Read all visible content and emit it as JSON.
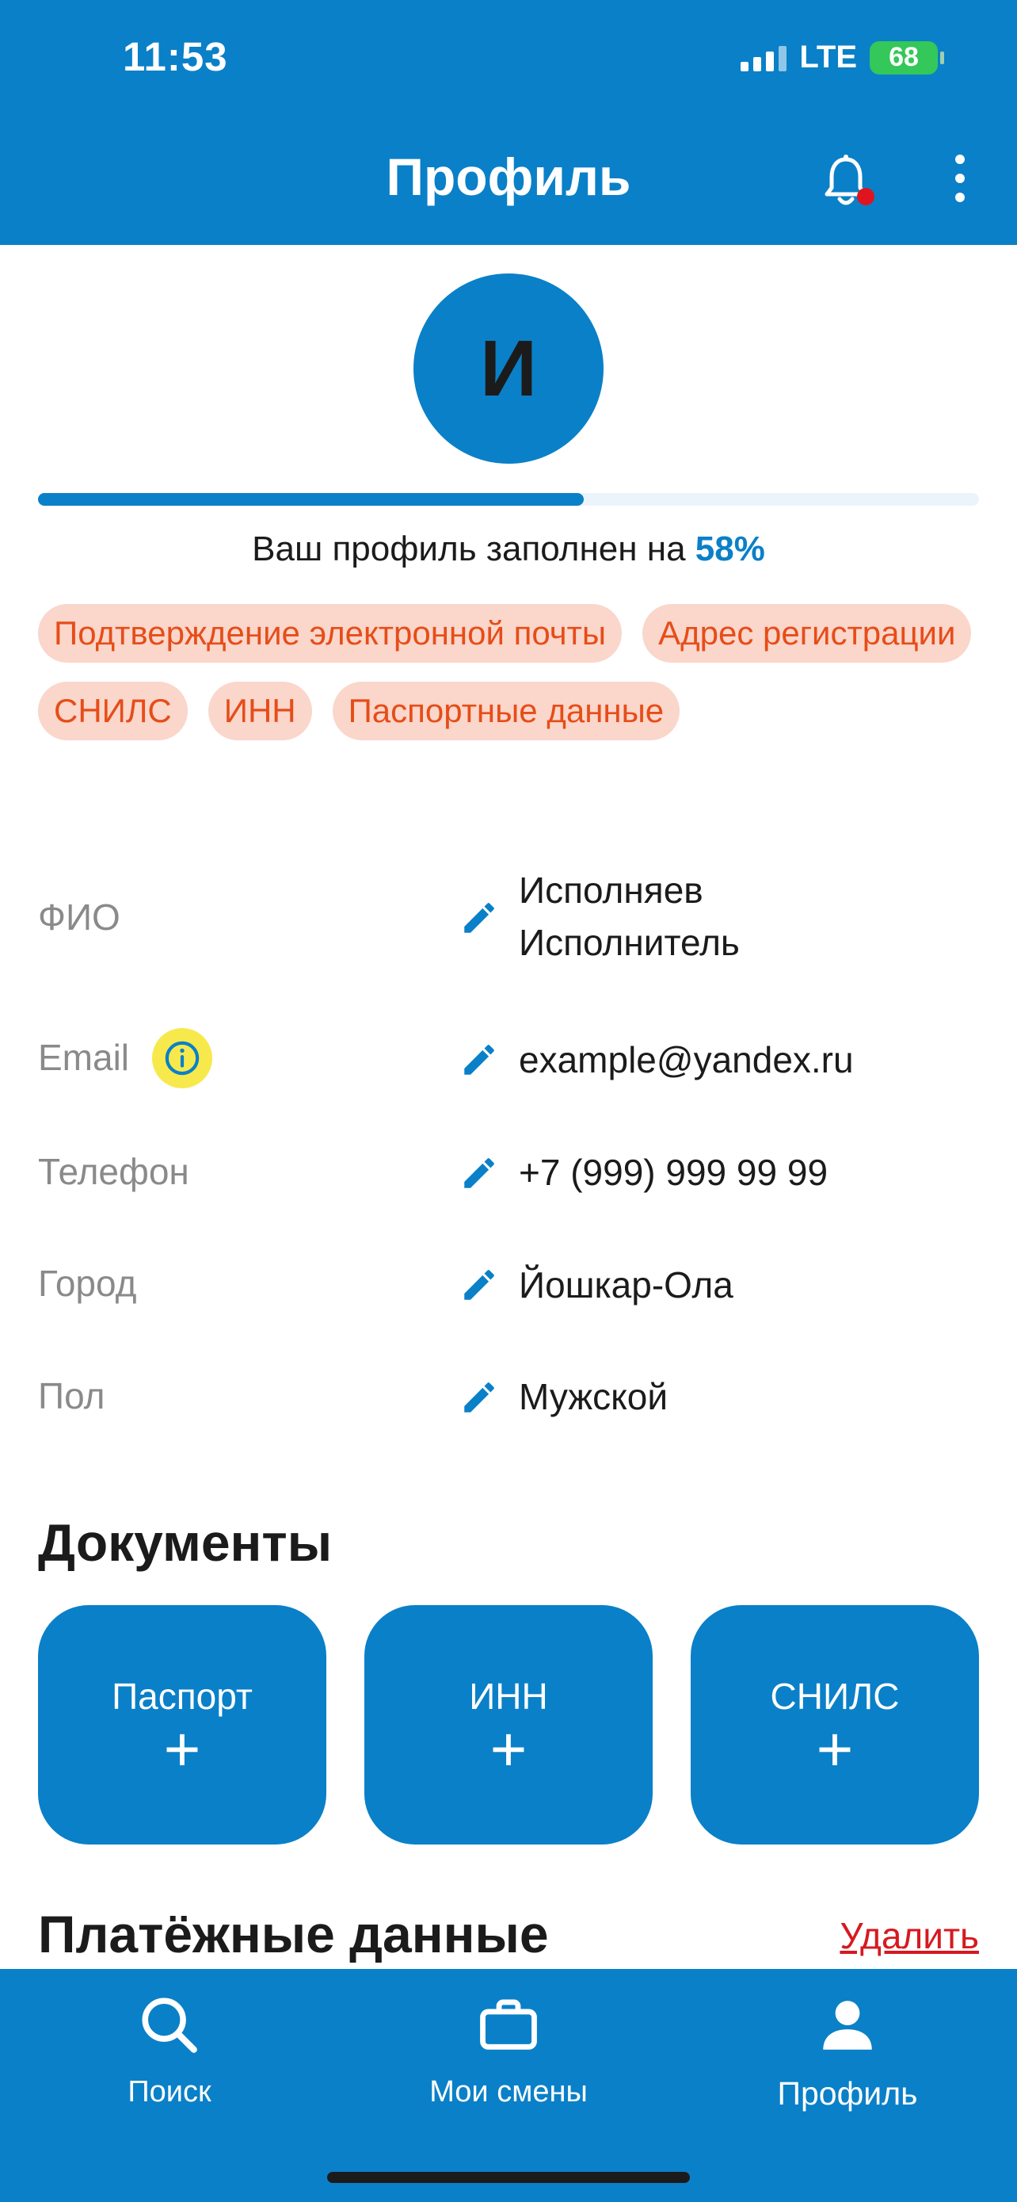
{
  "status_bar": {
    "time": "11:53",
    "network": "LTE",
    "battery": "68"
  },
  "header": {
    "title": "Профиль"
  },
  "avatar": {
    "initial": "И"
  },
  "profile_progress": {
    "text_prefix": "Ваш профиль заполнен на",
    "percent_text": "58%",
    "percent": 58
  },
  "missing_chips": [
    "Подтверждение электронной почты",
    "Адрес регистрации",
    "СНИЛС",
    "ИНН",
    "Паспортные данные"
  ],
  "fields": {
    "name": {
      "label": "ФИО",
      "value_line1": "Исполняев",
      "value_line2": "Исполнитель"
    },
    "email": {
      "label": "Email",
      "value": "example@yandex.ru"
    },
    "phone": {
      "label": "Телефон",
      "value": "+7 (999) 999 99 99"
    },
    "city": {
      "label": "Город",
      "value": "Йошкар-Ола"
    },
    "gender": {
      "label": "Пол",
      "value": "Мужской"
    }
  },
  "documents": {
    "title": "Документы",
    "cards": [
      {
        "label": "Паспорт",
        "plus": "+"
      },
      {
        "label": "ИНН",
        "plus": "+"
      },
      {
        "label": "СНИЛС",
        "plus": "+"
      }
    ]
  },
  "payment": {
    "title": "Платёжные данные",
    "delete_label": "Удалить"
  },
  "bottom_nav": [
    {
      "label": "Поиск",
      "icon": "search-icon"
    },
    {
      "label": "Мои смены",
      "icon": "briefcase-icon"
    },
    {
      "label": "Профиль",
      "icon": "person-icon",
      "active": true
    }
  ],
  "colors": {
    "primary": "#0a80c8",
    "chip_bg": "#fad6cb",
    "chip_text": "#e64d18",
    "danger": "#d71920",
    "info_badge": "#f7e94c"
  }
}
